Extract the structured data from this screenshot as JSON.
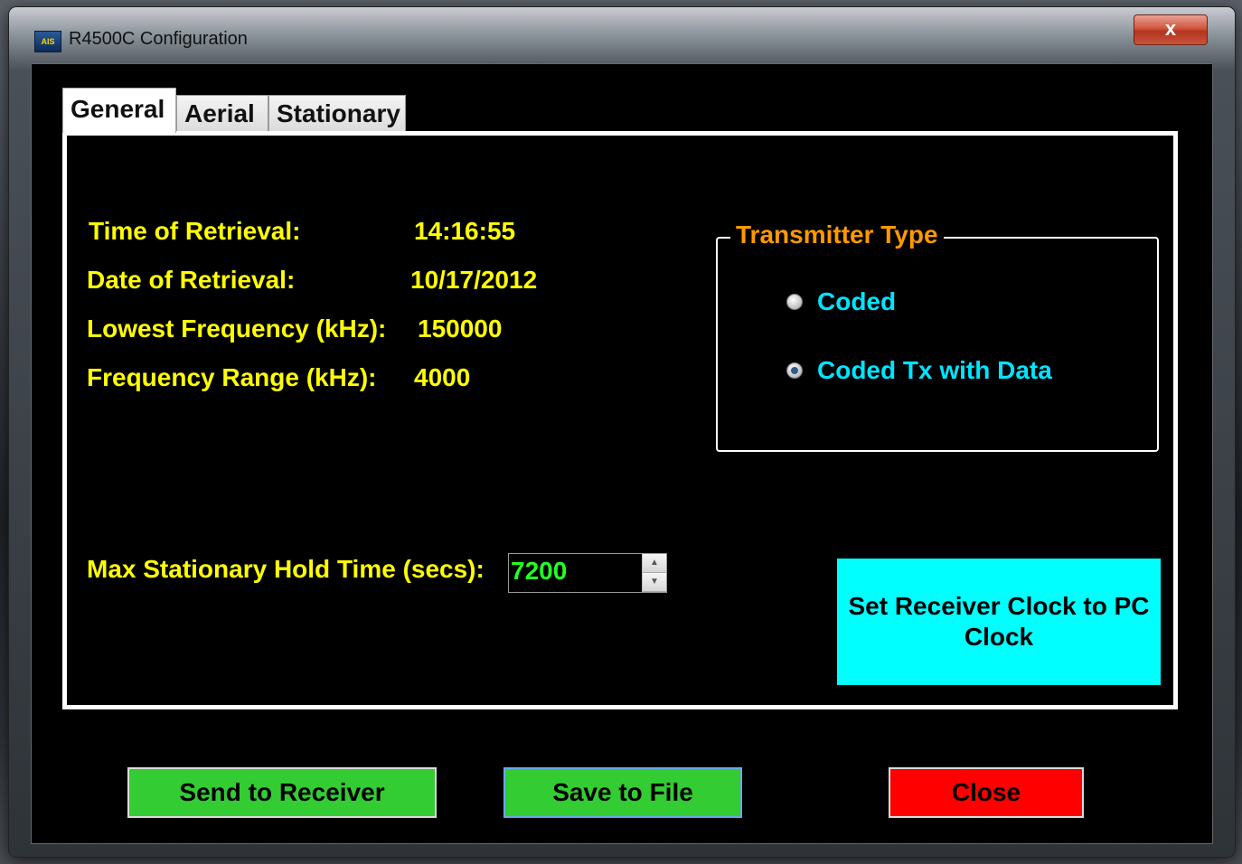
{
  "window": {
    "title": "R4500C Configuration",
    "close_glyph": "x",
    "icon_text": "AIS"
  },
  "tabs": [
    {
      "label": "General",
      "active": true
    },
    {
      "label": "Aerial",
      "active": false
    },
    {
      "label": "Stationary",
      "active": false
    }
  ],
  "info": {
    "time_label": "Time of Retrieval:",
    "time_value": "14:16:55",
    "date_label": "Date of Retrieval:",
    "date_value": "10/17/2012",
    "lowest_label": "Lowest Frequency (kHz):",
    "lowest_value": "150000",
    "range_label": "Frequency Range (kHz):",
    "range_value": "4000"
  },
  "transmitter": {
    "title": "Transmitter Type",
    "options": [
      {
        "label": "Coded",
        "checked": false
      },
      {
        "label": "Coded Tx with Data",
        "checked": true
      }
    ]
  },
  "hold": {
    "label": "Max Stationary Hold Time (secs):",
    "value": "7200"
  },
  "buttons": {
    "set_clock": "Set Receiver Clock to PC Clock",
    "send": "Send to Receiver",
    "save": "Save to File",
    "close": "Close"
  },
  "colors": {
    "label_yellow": "#ffff00",
    "group_title_orange": "#ff9900",
    "radio_cyan": "#00e5ff",
    "spinner_green": "#22ff22",
    "clock_button_cyan": "#00ffff",
    "button_green": "#33cc33",
    "button_red": "#ff0000"
  }
}
